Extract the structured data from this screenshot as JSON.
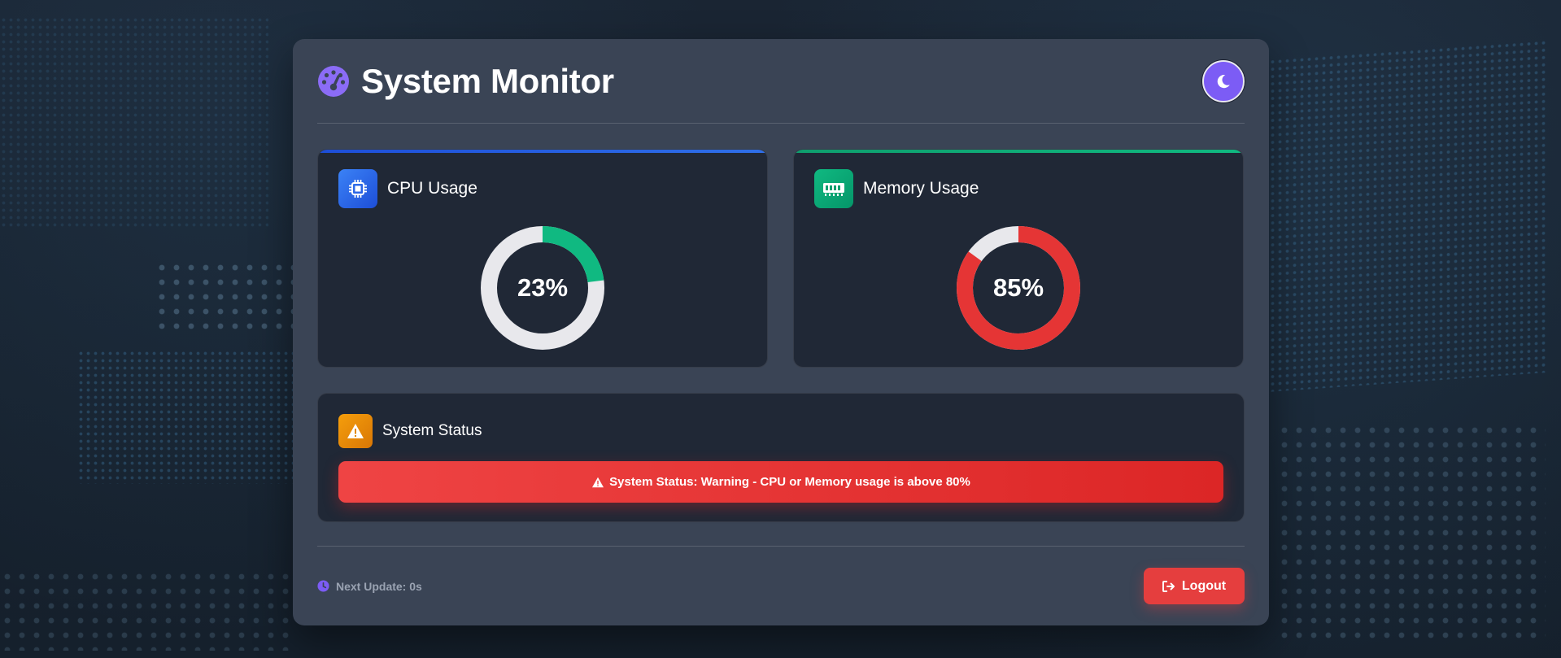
{
  "header": {
    "title": "System Monitor",
    "logo_icon": "tachometer-icon",
    "theme_toggle_icon": "moon-icon"
  },
  "cpu": {
    "title": "CPU Usage",
    "icon": "microchip-icon",
    "percent": 23,
    "percent_label": "23%",
    "accent_color": "#2563eb",
    "gauge_color": "#10b981"
  },
  "memory": {
    "title": "Memory Usage",
    "icon": "memory-icon",
    "percent": 85,
    "percent_label": "85%",
    "accent_color": "#10b981",
    "gauge_color": "#e53535"
  },
  "status": {
    "title": "System Status",
    "icon": "warning-triangle-icon",
    "message": "System Status: Warning - CPU or Memory usage is above 80%",
    "color": "#ef4444"
  },
  "footer": {
    "next_update": "Next Update: 0s",
    "clock_icon": "clock-icon",
    "logout_label": "Logout",
    "logout_icon": "sign-out-icon"
  },
  "colors": {
    "accent_purple": "#7c5cf5",
    "gauge_track": "#e8e8ec",
    "warning_orange": "#f59e0b"
  }
}
